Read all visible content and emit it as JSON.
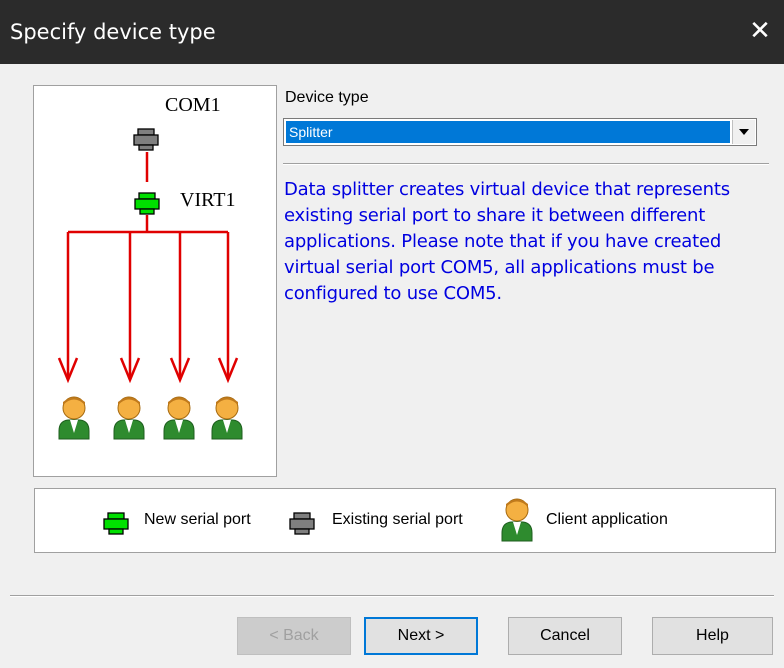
{
  "window": {
    "title": "Specify device type",
    "close_glyph": "✕"
  },
  "diagram": {
    "top_device_label": "COM1",
    "virtual_device_label": "VIRT1"
  },
  "device_type": {
    "label": "Device type",
    "selected": "Splitter",
    "description": "Data splitter creates virtual device that represents existing serial port to share it between different applications. Please note that if you have created virtual serial port COM5, all applications must be configured to use COM5."
  },
  "legend": {
    "new_port": "New serial port",
    "existing_port": "Existing serial port",
    "client_app": "Client application"
  },
  "buttons": {
    "back": "< Back",
    "next": "Next >",
    "cancel": "Cancel",
    "help": "Help"
  },
  "colors": {
    "new_port": "#00e000",
    "existing_port": "#7f7f7f",
    "connector": "#e00000",
    "description_text": "#0000e0",
    "selection": "#0078d7"
  }
}
